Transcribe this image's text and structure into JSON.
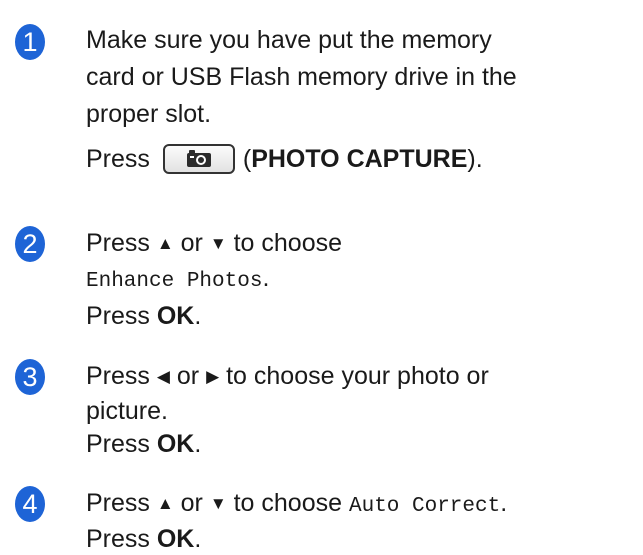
{
  "steps": [
    {
      "number": "1",
      "lines": [
        "Make sure you have put the memory",
        "card or USB Flash memory drive in the",
        "proper slot."
      ],
      "press_prefix": "Press",
      "press_open": "(",
      "press_bold": "PHOTO CAPTURE",
      "press_close": ").",
      "button_icon": "camera-icon"
    },
    {
      "number": "2",
      "press": "Press",
      "up": "▲",
      "or": "or",
      "down": "▼",
      "to_choose": "to choose",
      "option": "Enhance Photos",
      "option_end": ".",
      "press2": "Press",
      "ok": "OK",
      "end": "."
    },
    {
      "number": "3",
      "press": "Press",
      "left": "◀",
      "or": "or",
      "right": "▶",
      "text_a": "to choose your photo or",
      "text_b": "picture.",
      "press2": "Press",
      "ok": "OK",
      "end": "."
    },
    {
      "number": "4",
      "press": "Press",
      "up": "▲",
      "or": "or",
      "down": "▼",
      "to_choose": "to choose",
      "option": "Auto Correct",
      "option_end": ".",
      "press2": "Press",
      "ok": "OK",
      "end": "."
    }
  ],
  "colors": {
    "badge": "#1e64d6",
    "text": "#1a1a1a"
  }
}
